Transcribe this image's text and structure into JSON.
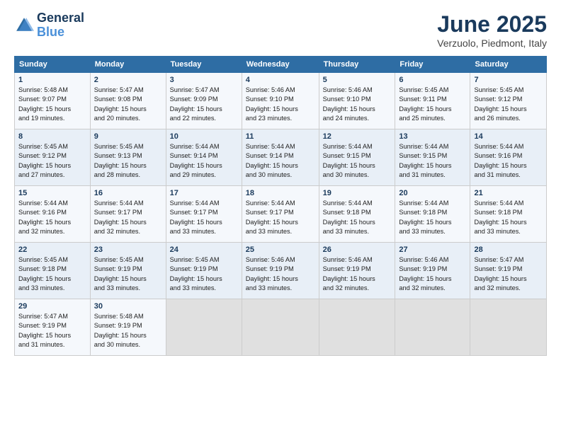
{
  "logo": {
    "line1": "General",
    "line2": "Blue"
  },
  "title": "June 2025",
  "subtitle": "Verzuolo, Piedmont, Italy",
  "header_days": [
    "Sunday",
    "Monday",
    "Tuesday",
    "Wednesday",
    "Thursday",
    "Friday",
    "Saturday"
  ],
  "weeks": [
    [
      {
        "day": "1",
        "text": "Sunrise: 5:48 AM\nSunset: 9:07 PM\nDaylight: 15 hours\nand 19 minutes."
      },
      {
        "day": "2",
        "text": "Sunrise: 5:47 AM\nSunset: 9:08 PM\nDaylight: 15 hours\nand 20 minutes."
      },
      {
        "day": "3",
        "text": "Sunrise: 5:47 AM\nSunset: 9:09 PM\nDaylight: 15 hours\nand 22 minutes."
      },
      {
        "day": "4",
        "text": "Sunrise: 5:46 AM\nSunset: 9:10 PM\nDaylight: 15 hours\nand 23 minutes."
      },
      {
        "day": "5",
        "text": "Sunrise: 5:46 AM\nSunset: 9:10 PM\nDaylight: 15 hours\nand 24 minutes."
      },
      {
        "day": "6",
        "text": "Sunrise: 5:45 AM\nSunset: 9:11 PM\nDaylight: 15 hours\nand 25 minutes."
      },
      {
        "day": "7",
        "text": "Sunrise: 5:45 AM\nSunset: 9:12 PM\nDaylight: 15 hours\nand 26 minutes."
      }
    ],
    [
      {
        "day": "8",
        "text": "Sunrise: 5:45 AM\nSunset: 9:12 PM\nDaylight: 15 hours\nand 27 minutes."
      },
      {
        "day": "9",
        "text": "Sunrise: 5:45 AM\nSunset: 9:13 PM\nDaylight: 15 hours\nand 28 minutes."
      },
      {
        "day": "10",
        "text": "Sunrise: 5:44 AM\nSunset: 9:14 PM\nDaylight: 15 hours\nand 29 minutes."
      },
      {
        "day": "11",
        "text": "Sunrise: 5:44 AM\nSunset: 9:14 PM\nDaylight: 15 hours\nand 30 minutes."
      },
      {
        "day": "12",
        "text": "Sunrise: 5:44 AM\nSunset: 9:15 PM\nDaylight: 15 hours\nand 30 minutes."
      },
      {
        "day": "13",
        "text": "Sunrise: 5:44 AM\nSunset: 9:15 PM\nDaylight: 15 hours\nand 31 minutes."
      },
      {
        "day": "14",
        "text": "Sunrise: 5:44 AM\nSunset: 9:16 PM\nDaylight: 15 hours\nand 31 minutes."
      }
    ],
    [
      {
        "day": "15",
        "text": "Sunrise: 5:44 AM\nSunset: 9:16 PM\nDaylight: 15 hours\nand 32 minutes."
      },
      {
        "day": "16",
        "text": "Sunrise: 5:44 AM\nSunset: 9:17 PM\nDaylight: 15 hours\nand 32 minutes."
      },
      {
        "day": "17",
        "text": "Sunrise: 5:44 AM\nSunset: 9:17 PM\nDaylight: 15 hours\nand 33 minutes."
      },
      {
        "day": "18",
        "text": "Sunrise: 5:44 AM\nSunset: 9:17 PM\nDaylight: 15 hours\nand 33 minutes."
      },
      {
        "day": "19",
        "text": "Sunrise: 5:44 AM\nSunset: 9:18 PM\nDaylight: 15 hours\nand 33 minutes."
      },
      {
        "day": "20",
        "text": "Sunrise: 5:44 AM\nSunset: 9:18 PM\nDaylight: 15 hours\nand 33 minutes."
      },
      {
        "day": "21",
        "text": "Sunrise: 5:44 AM\nSunset: 9:18 PM\nDaylight: 15 hours\nand 33 minutes."
      }
    ],
    [
      {
        "day": "22",
        "text": "Sunrise: 5:45 AM\nSunset: 9:18 PM\nDaylight: 15 hours\nand 33 minutes."
      },
      {
        "day": "23",
        "text": "Sunrise: 5:45 AM\nSunset: 9:19 PM\nDaylight: 15 hours\nand 33 minutes."
      },
      {
        "day": "24",
        "text": "Sunrise: 5:45 AM\nSunset: 9:19 PM\nDaylight: 15 hours\nand 33 minutes."
      },
      {
        "day": "25",
        "text": "Sunrise: 5:46 AM\nSunset: 9:19 PM\nDaylight: 15 hours\nand 33 minutes."
      },
      {
        "day": "26",
        "text": "Sunrise: 5:46 AM\nSunset: 9:19 PM\nDaylight: 15 hours\nand 32 minutes."
      },
      {
        "day": "27",
        "text": "Sunrise: 5:46 AM\nSunset: 9:19 PM\nDaylight: 15 hours\nand 32 minutes."
      },
      {
        "day": "28",
        "text": "Sunrise: 5:47 AM\nSunset: 9:19 PM\nDaylight: 15 hours\nand 32 minutes."
      }
    ],
    [
      {
        "day": "29",
        "text": "Sunrise: 5:47 AM\nSunset: 9:19 PM\nDaylight: 15 hours\nand 31 minutes."
      },
      {
        "day": "30",
        "text": "Sunrise: 5:48 AM\nSunset: 9:19 PM\nDaylight: 15 hours\nand 30 minutes."
      },
      {
        "day": "",
        "text": ""
      },
      {
        "day": "",
        "text": ""
      },
      {
        "day": "",
        "text": ""
      },
      {
        "day": "",
        "text": ""
      },
      {
        "day": "",
        "text": ""
      }
    ]
  ]
}
